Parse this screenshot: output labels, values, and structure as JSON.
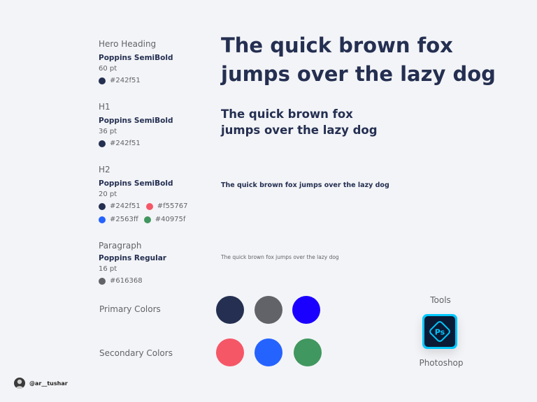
{
  "specs": {
    "hero": {
      "label": "Hero Heading",
      "font": "Poppins SemiBold",
      "size": "60 pt",
      "colors": [
        {
          "hex": "#242f51",
          "text": "#242f51"
        }
      ]
    },
    "h1": {
      "label": "H1",
      "font": "Poppins SemiBold",
      "size": "36 pt",
      "colors": [
        {
          "hex": "#242f51",
          "text": "#242f51"
        }
      ]
    },
    "h2": {
      "label": "H2",
      "font": "Poppins SemiBold",
      "size": "20 pt",
      "colors": [
        {
          "hex": "#242f51",
          "text": "#242f51"
        },
        {
          "hex": "#f55767",
          "text": "#f55767"
        },
        {
          "hex": "#2563ff",
          "text": "#2563ff"
        },
        {
          "hex": "#40975f",
          "text": "#40975f"
        }
      ]
    },
    "paragraph": {
      "label": "Paragraph",
      "font": "Poppins Regular",
      "size": "16 pt",
      "colors": [
        {
          "hex": "#616368",
          "text": "#616368"
        }
      ]
    }
  },
  "samples": {
    "hero_line1": "The quick brown fox",
    "hero_line2": "jumps over the lazy dog",
    "h1_line1": "The quick brown fox",
    "h1_line2": "jumps over the lazy dog",
    "h2": "The quick brown fox jumps over the lazy dog",
    "paragraph": "The quick brown fox jumps over the lazy dog"
  },
  "palette": {
    "primary_label": "Primary Colors",
    "primary": [
      "#242f51",
      "#616368",
      "#1a00ff"
    ],
    "secondary_label": "Secondary Colors",
    "secondary": [
      "#f55767",
      "#2563ff",
      "#40975f"
    ]
  },
  "tools": {
    "label": "Tools",
    "app_name": "Photoshop",
    "app_icon": "photoshop-icon",
    "icon_text": "Ps"
  },
  "footer": {
    "handle": "@ar__tushar"
  }
}
